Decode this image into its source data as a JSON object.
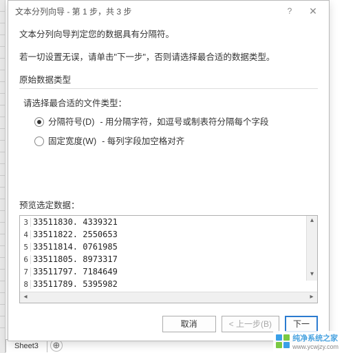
{
  "dialog": {
    "title": "文本分列向导 - 第 1 步，共 3 步",
    "help_icon": "?",
    "close_icon": "✕",
    "intro1": "文本分列向导判定您的数据具有分隔符。",
    "intro2": "若一切设置无误，请单击\"下一步\"，否则请选择最合适的数据类型。",
    "fieldset_legend": "原始数据类型",
    "prompt": "请选择最合适的文件类型：",
    "radio_delimited_label": "分隔符号(D)",
    "radio_delimited_desc": "- 用分隔字符，如逗号或制表符分隔每个字段",
    "radio_fixed_label": "固定宽度(W)",
    "radio_fixed_desc": "- 每列字段加空格对齐",
    "preview_legend": "预览选定数据：",
    "preview_rows": [
      {
        "n": "3",
        "v": "33511830. 4339321"
      },
      {
        "n": "4",
        "v": "33511822. 2550653"
      },
      {
        "n": "5",
        "v": "33511814. 0761985"
      },
      {
        "n": "6",
        "v": "33511805. 8973317"
      },
      {
        "n": "7",
        "v": "33511797. 7184649"
      },
      {
        "n": "8",
        "v": "33511789. 5395982"
      }
    ],
    "buttons": {
      "cancel": "取消",
      "back": "< 上一步(B)",
      "next": "下一"
    }
  },
  "sheet": {
    "tab": "Sheet3",
    "add": "⊕"
  },
  "watermark": {
    "text": "纯净系统之家",
    "url": "www.ycwjzy.com"
  }
}
